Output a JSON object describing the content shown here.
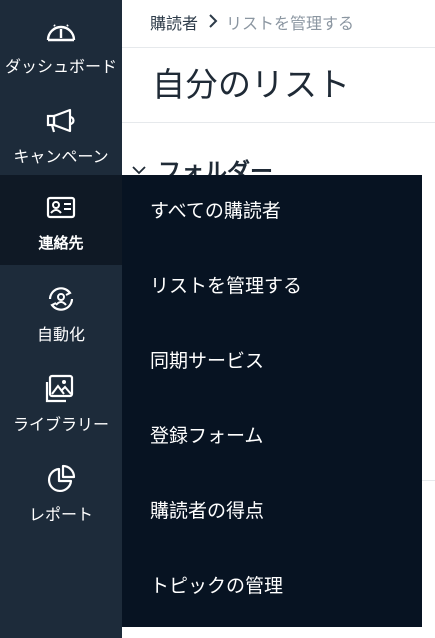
{
  "sidebar": {
    "items": [
      {
        "label": "ダッシュボード",
        "icon": "dashboard-gauge-icon"
      },
      {
        "label": "キャンペーン",
        "icon": "megaphone-icon"
      },
      {
        "label": "連絡先",
        "icon": "contact-card-icon"
      },
      {
        "label": "自動化",
        "icon": "automation-person-icon"
      },
      {
        "label": "ライブラリー",
        "icon": "image-library-icon"
      },
      {
        "label": "レポート",
        "icon": "pie-chart-icon"
      }
    ],
    "active_index": 2
  },
  "breadcrumb": {
    "parent": "購読者",
    "separator": "›",
    "current": "リストを管理する"
  },
  "page": {
    "title": "自分のリスト",
    "folder_header": "フォルダー",
    "folder_caret": "⌄"
  },
  "flyout": {
    "items": [
      {
        "label": "すべての購読者"
      },
      {
        "label": "リストを管理する"
      },
      {
        "label": "同期サービス"
      },
      {
        "label": "登録フォーム"
      },
      {
        "label": "購読者の得点"
      },
      {
        "label": "トピックの管理"
      }
    ]
  },
  "colors": {
    "sidebar_bg": "#1d2b3a",
    "sidebar_active_bg": "#0f1925",
    "flyout_bg": "#071322",
    "text_dark": "#1f2a36",
    "breadcrumb_muted": "#8b96a1"
  }
}
